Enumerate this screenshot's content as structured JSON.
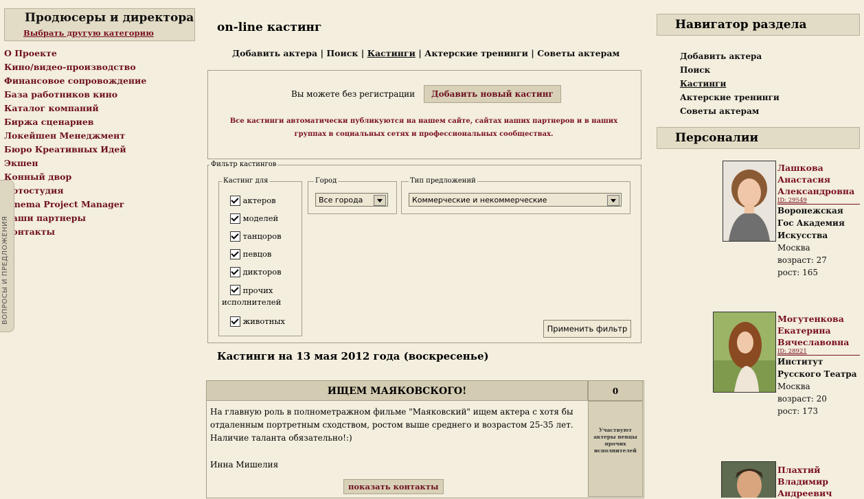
{
  "left": {
    "title": "Продюсеры и директора",
    "change_category": "Выбрать другую категорию",
    "menu": [
      "О Проекте",
      "Кино/видео-производство",
      "Финансовое сопровождение",
      "База работников кино",
      "Каталог компаний",
      "Биржа сценариев",
      "Локейшен Менеджмент",
      "Бюро Креативных Идей",
      "Экшен",
      "Конный двор",
      "Фотостудия",
      "Cinema Project Manager",
      "Наши партнеры",
      "Контакты"
    ],
    "feedback_tab": "ВОПРОСЫ И ПРЕДЛОЖЕНИЯ"
  },
  "center": {
    "title": "on-line кастинг",
    "nav": [
      "Добавить актера",
      "Поиск",
      "Кастинги",
      "Актерские тренинги",
      "Советы актерам"
    ],
    "nav_active_index": 2,
    "register_text": "Вы можете без регистрации",
    "add_casting_button": "Добавить новый кастинг",
    "notice": "Все кастинги автоматически публикуются на нашем сайте, сайтах наших партнеров и в наших группах в социальных сетях и профессиональных сообществах.",
    "filter": {
      "legend": "Фильтр кастингов",
      "cast_for_legend": "Кастинг для",
      "options": [
        "актеров",
        "моделей",
        "танцоров",
        "певцов",
        "дикторов",
        "прочих исполнителей",
        "животных"
      ],
      "city_legend": "Город",
      "city_value": "Все города",
      "type_legend": "Тип предложений",
      "type_value": "Коммерческие и некоммерческие",
      "apply_button": "Применить фильтр"
    },
    "date_heading": "Кастинги на 13 мая 2012 года (воскресенье)",
    "casting": {
      "title": "ИЩЕМ МАЯКОВСКОГО!",
      "count": "0",
      "body": "На главную роль в полнометражном фильме \"Маяковский\" ищем актера с хотя бы отдаленным портретным сходством, ростом выше среднего и возрастом 25-35 лет. Наличие таланта обязательно!:)",
      "author": "Инна Мишелия",
      "participants": "Участвуют актеры певцы прочих исполнителей",
      "show_contacts": "показать контакты"
    }
  },
  "right": {
    "nav_title": "Навигатор раздела",
    "nav": [
      "Добавить актера",
      "Поиск",
      "Кастинги",
      "Актерские тренинги",
      "Советы актерам"
    ],
    "nav_active_index": 2,
    "persons_title": "Персоналии",
    "persons": [
      {
        "name": "Лашкова Анастасия Александровна",
        "id": "ID: 29549",
        "school": "Воронежская Гос Академия Искусства",
        "city": "Москва",
        "age": "возраст: 27",
        "height": "рост: 165"
      },
      {
        "name": "Могутенкова Екатерина Вячеславовна",
        "id": "ID: 28921",
        "school": "Институт Русского Театра",
        "city": "Москва",
        "age": "возраст: 20",
        "height": "рост: 173"
      },
      {
        "name": "Плахтий Владимир Андреевич"
      }
    ]
  }
}
